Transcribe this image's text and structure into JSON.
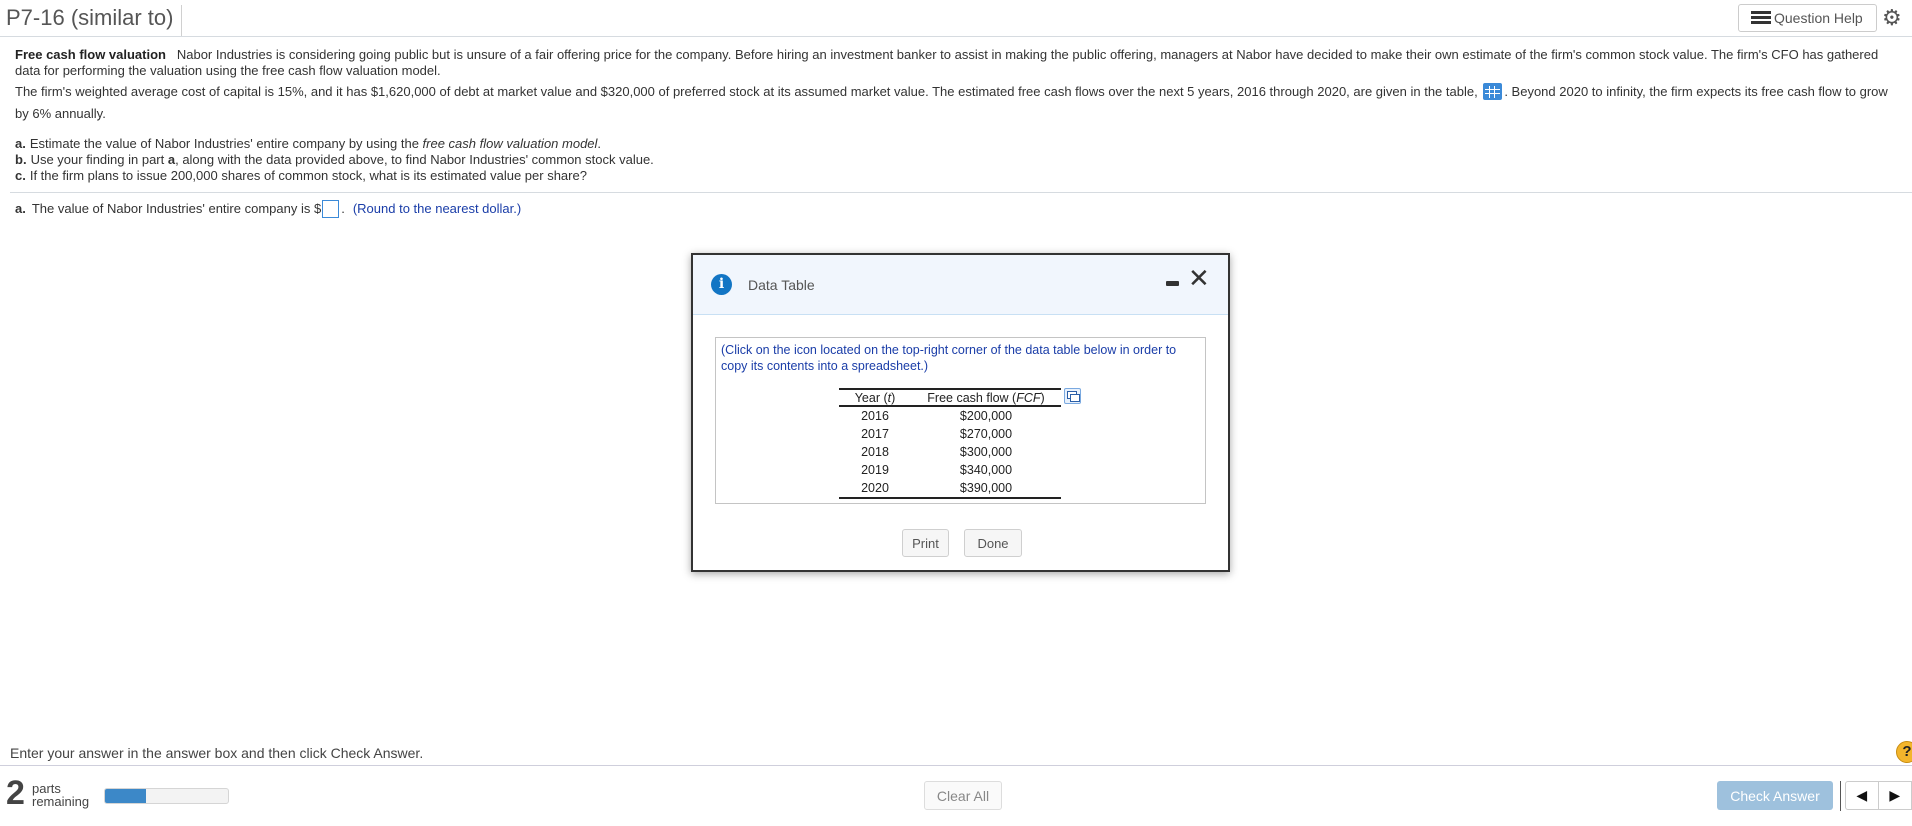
{
  "header": {
    "title": "P7-16 (similar to)",
    "question_help_label": "Question Help",
    "icons": {
      "question_help": "list-icon",
      "settings": "gear-icon"
    }
  },
  "question": {
    "heading": "Free cash flow valuation",
    "paragraph1": "Nabor Industries is considering going public but is unsure of a fair offering price for the company. Before hiring an investment banker to assist in making the public offering, managers at Nabor have decided to make their own estimate of the firm's common stock value. The firm's CFO has gathered data for performing the valuation using the free cash flow valuation model.",
    "paragraph2_before_icon": "The firm's weighted average cost of capital is 15%, and it has $1,620,000 of debt at market value and $320,000 of preferred stock at its assumed market value.  The estimated free cash flows over the next 5 years, 2016 through 2020, are given in the table,",
    "paragraph2_after_icon": ".  Beyond 2020 to infinity, the firm expects its free cash flow to grow by 6% annually.",
    "table_icon": "table-grid-icon",
    "parts": [
      {
        "label": "a.",
        "text_before": "Estimate the value of Nabor Industries' entire company by using the ",
        "text_italic": "free cash flow valuation model",
        "text_after": "."
      },
      {
        "label": "b.",
        "text_before": "Use your finding in part ",
        "text_bold": "a",
        "text_after": ", along with the data provided above, to find Nabor Industries' common stock value."
      },
      {
        "label": "c.",
        "text": "If the firm plans to issue 200,000 shares of common stock, what is its estimated value per share?"
      }
    ]
  },
  "answer": {
    "label": "a.",
    "prompt": "The value of Nabor Industries' entire company is $",
    "value": "",
    "suffix": ".",
    "hint": "(Round to the nearest dollar.)"
  },
  "modal": {
    "title": "Data Table",
    "note": "(Click on the icon located on the top-right corner of the data table below in order to copy its contents into a spreadsheet.)",
    "table": {
      "headers": [
        {
          "text": "Year (",
          "italic": "t",
          "close": ")"
        },
        {
          "text": "Free cash flow (",
          "italic": "FCF",
          "close": ")"
        }
      ],
      "rows": [
        [
          "2016",
          "$200,000"
        ],
        [
          "2017",
          "$270,000"
        ],
        [
          "2018",
          "$300,000"
        ],
        [
          "2019",
          "$340,000"
        ],
        [
          "2020",
          "$390,000"
        ]
      ]
    },
    "print_label": "Print",
    "done_label": "Done"
  },
  "footer": {
    "instruction": "Enter your answer in the answer box and then click Check Answer.",
    "parts_count": "2",
    "parts_label_1": "parts",
    "parts_label_2": "remaining",
    "progress_fraction": 0.33,
    "clear_all_label": "Clear All",
    "check_answer_label": "Check Answer",
    "help_symbol": "?"
  }
}
